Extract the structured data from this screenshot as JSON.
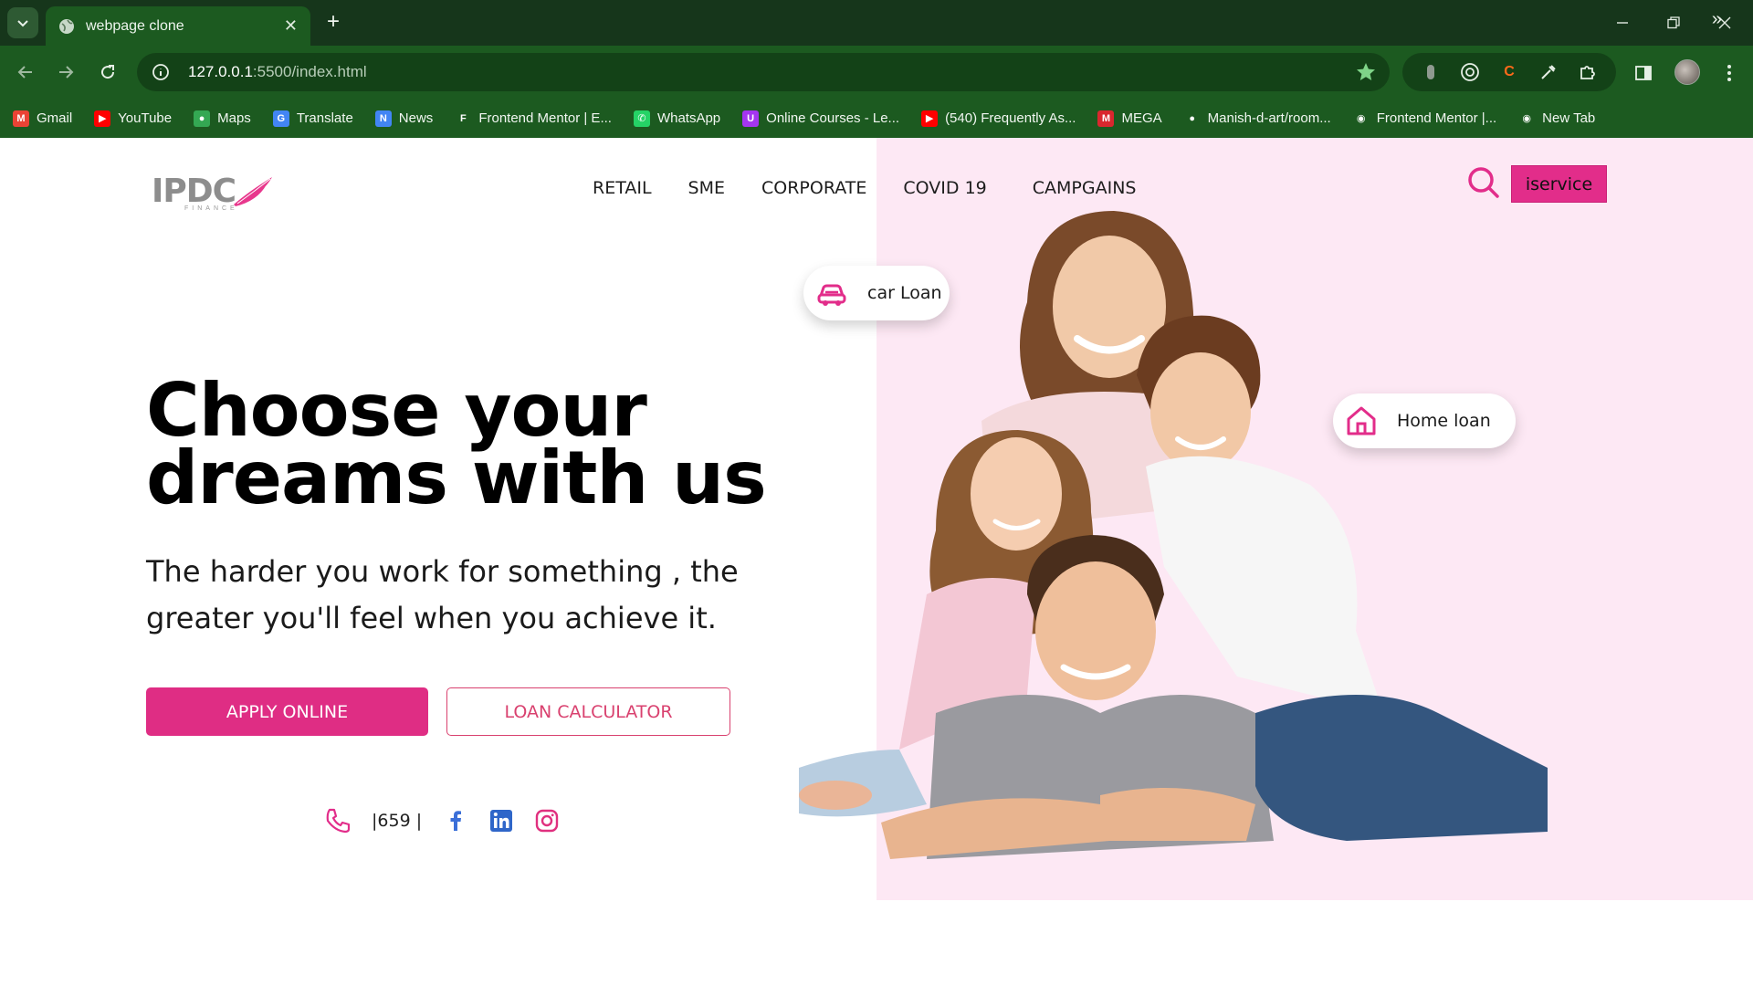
{
  "browser": {
    "tab_title": "webpage clone",
    "url_host": "127.0.0.1",
    "url_path": ":5500/index.html",
    "bookmarks": [
      {
        "label": "Gmail",
        "icon": "gmail-icon",
        "color": "#ea4335"
      },
      {
        "label": "YouTube",
        "icon": "youtube-icon",
        "color": "#ff0000"
      },
      {
        "label": "Maps",
        "icon": "maps-icon",
        "color": "#34a853"
      },
      {
        "label": "Translate",
        "icon": "translate-icon",
        "color": "#4285f4"
      },
      {
        "label": "News",
        "icon": "news-icon",
        "color": "#4285f4"
      },
      {
        "label": "Frontend Mentor | E...",
        "icon": "frontend-mentor-icon",
        "color": "#ffffff"
      },
      {
        "label": "WhatsApp",
        "icon": "whatsapp-icon",
        "color": "#25d366"
      },
      {
        "label": "Online Courses - Le...",
        "icon": "udemy-icon",
        "color": "#a435f0"
      },
      {
        "label": "(540) Frequently As...",
        "icon": "youtube-icon",
        "color": "#ff0000"
      },
      {
        "label": "MEGA",
        "icon": "mega-icon",
        "color": "#d9272e"
      },
      {
        "label": "Manish-d-art/room...",
        "icon": "github-icon",
        "color": "#ffffff"
      },
      {
        "label": "Frontend Mentor |...",
        "icon": "globe-icon",
        "color": "#ffffff"
      },
      {
        "label": "New Tab",
        "icon": "globe-icon",
        "color": "#ffffff"
      }
    ]
  },
  "site": {
    "logo_text": "IPDC",
    "logo_sub": "FINANCE",
    "nav": [
      "RETAIL",
      "SME",
      "CORPORATE",
      "COVID 19",
      "CAMPGAINS"
    ],
    "iservice_label": "iservice",
    "hero_title_line1": "Choose your",
    "hero_title_line2": "dreams with us",
    "hero_subtitle": "The harder you work for something , the greater you'll feel when you achieve it.",
    "apply_label": "APPLY ONLINE",
    "calculator_label": "LOAN CALCULATOR",
    "phone_number": "|659 |",
    "car_loan_label": "car Loan",
    "home_loan_label": "Home loan",
    "colors": {
      "brand_pink": "#df2d84",
      "panel_pink": "#fde8f4",
      "chrome_green": "#1c5a20"
    }
  }
}
